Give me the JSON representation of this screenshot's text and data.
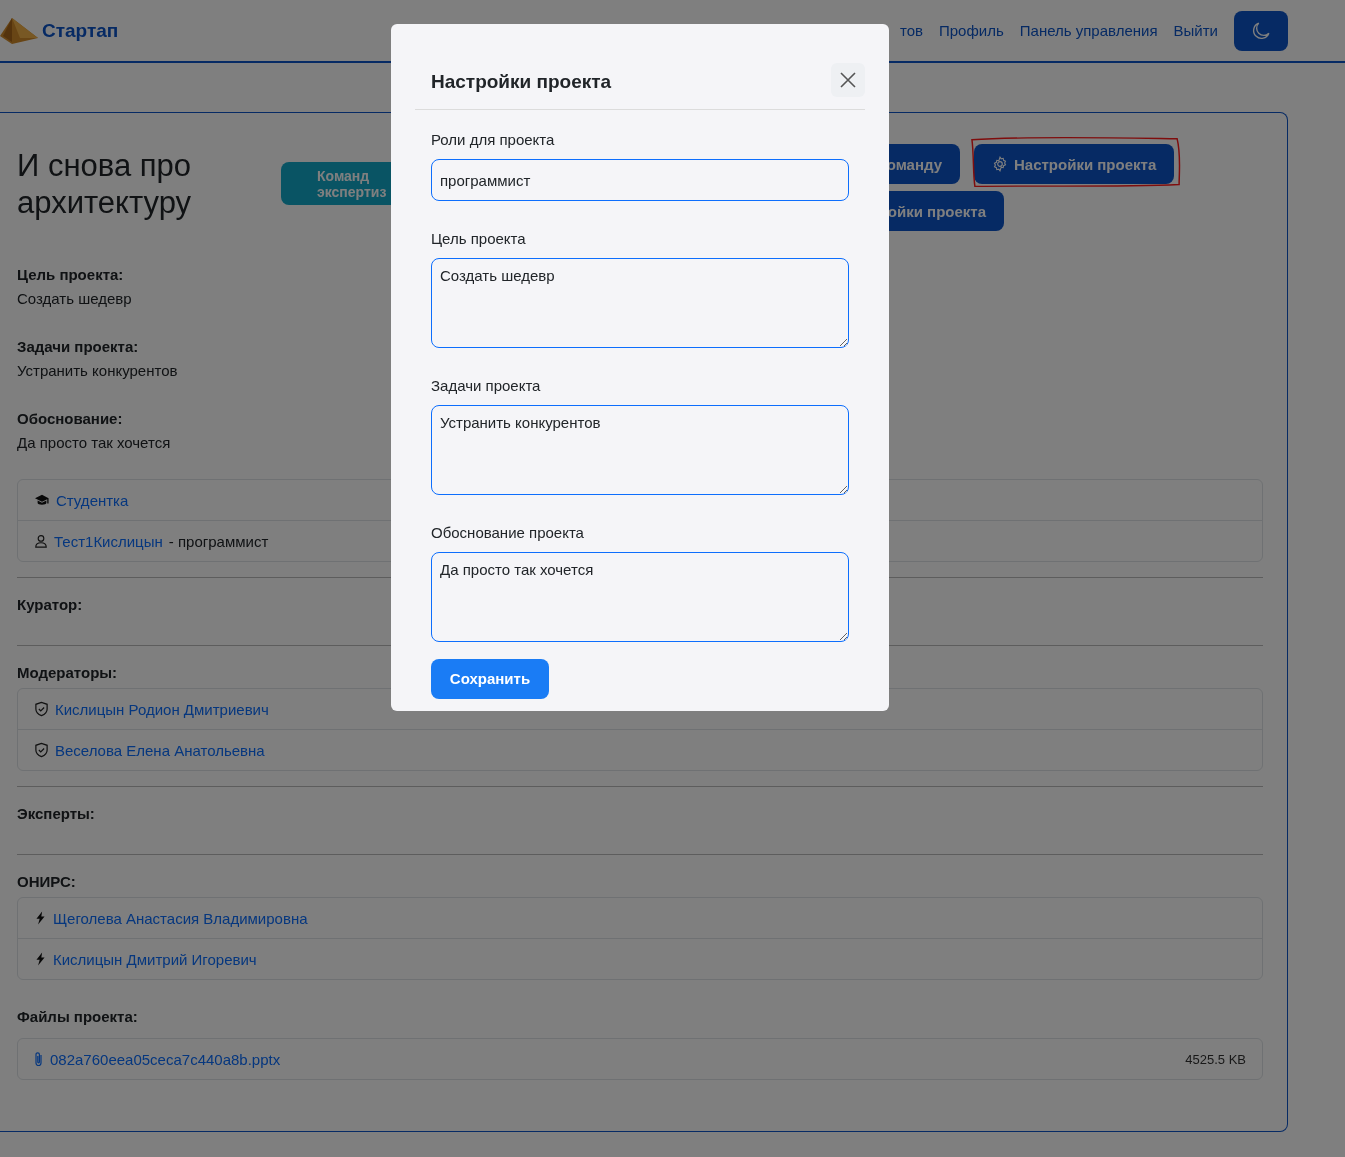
{
  "navbar": {
    "brand": "Стартап",
    "links": [
      "тов",
      "Профиль",
      "Панель управления",
      "Выйти"
    ]
  },
  "project": {
    "title": "И снова про архитектуру",
    "actions": [
      {
        "label": "Команд экспертиз",
        "kind": "teal"
      },
      {
        "label": "оманду",
        "kind": "primary"
      },
      {
        "label": "Настройки проекта",
        "kind": "settings",
        "highlighted": true
      },
      {
        "label": "ойки проекта",
        "kind": "primary"
      }
    ],
    "fields": [
      {
        "label": "Цель проекта:",
        "value": "Создать шедевр"
      },
      {
        "label": "Задачи проекта:",
        "value": "Устранить конкурентов"
      },
      {
        "label": "Обоснование:",
        "value": "Да просто так хочется"
      }
    ],
    "team": [
      {
        "kind": "team",
        "name": "Студентка"
      },
      {
        "kind": "member",
        "name": "Тест1Кислицын",
        "role": "- программист"
      }
    ],
    "sections": [
      {
        "title": "Куратор:"
      },
      {
        "title": "Модераторы:",
        "items": [
          {
            "kind": "moderator",
            "name": "Кислицын Родион Дмитриевич"
          },
          {
            "kind": "moderator",
            "name": "Веселова Елена Анатольевна"
          }
        ]
      },
      {
        "title": "Эксперты:"
      },
      {
        "title": "ОНИРС:",
        "items": [
          {
            "kind": "onirs",
            "name": "Щеголева Анастасия Владимировна"
          },
          {
            "kind": "onirs",
            "name": "Кислицын Дмитрий Игоревич"
          }
        ]
      }
    ],
    "files": {
      "title": "Файлы проекта:",
      "items": [
        {
          "name": "082a760eea05ceca7c440a8b.pptx",
          "size": "4525.5 KB"
        }
      ]
    }
  },
  "modal": {
    "title": "Настройки проекта",
    "fields": [
      {
        "label": "Роли для проекта",
        "kind": "input",
        "value": "программист"
      },
      {
        "label": "Цель проекта",
        "kind": "textarea",
        "value": "Создать шедевр"
      },
      {
        "label": "Задачи проекта",
        "kind": "textarea",
        "value": "Устранить конкурентов"
      },
      {
        "label": "Обоснование проекта",
        "kind": "textarea",
        "value": "Да просто так хочется"
      }
    ],
    "save_button": "Сохранить"
  }
}
